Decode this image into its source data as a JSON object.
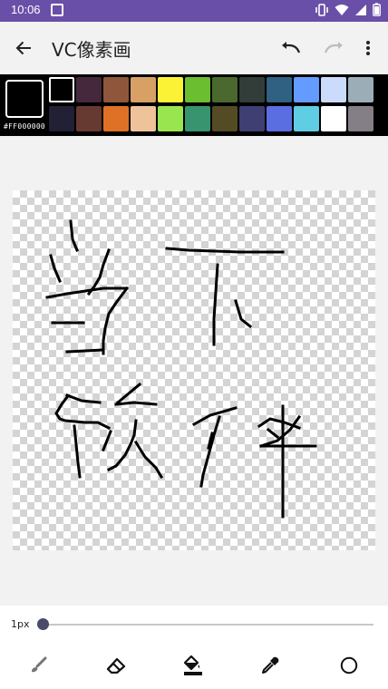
{
  "status_bar": {
    "time": "10:06"
  },
  "app_bar": {
    "title": "VC像素画"
  },
  "palette": {
    "current_hex": "#FF000000",
    "current_color": "#000000",
    "swatches": [
      "#000000",
      "#45283c",
      "#8f563b",
      "#d9a066",
      "#fbf236",
      "#6abe30",
      "#4b692f",
      "#323c39",
      "#306082",
      "#639bff",
      "#cbdbfc",
      "#9badb7",
      "#222034",
      "#663931",
      "#df7126",
      "#eec39a",
      "#99e550",
      "#37946e",
      "#524b24",
      "#3f3f74",
      "#5b6ee1",
      "#5fcde4",
      "#ffffff",
      "#847e87"
    ],
    "selected_index": 0
  },
  "brush": {
    "size_label": "1px",
    "level": 0
  },
  "tools": [
    {
      "name": "brush-tool",
      "icon": "brush-icon"
    },
    {
      "name": "eraser-tool",
      "icon": "eraser-icon"
    },
    {
      "name": "fill-tool",
      "icon": "fill-icon"
    },
    {
      "name": "eyedropper-tool",
      "icon": "eyedropper-icon"
    },
    {
      "name": "shape-tool",
      "icon": "circle-icon"
    }
  ]
}
